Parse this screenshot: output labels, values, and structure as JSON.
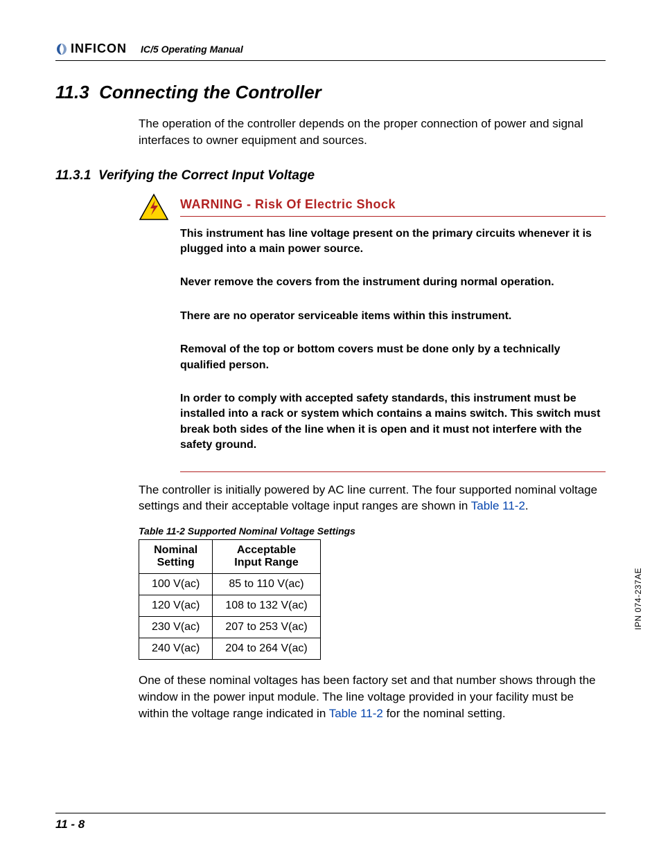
{
  "header": {
    "brand": "INFICON",
    "manual": "IC/5 Operating Manual"
  },
  "section": {
    "number": "11.3",
    "title": "Connecting the Controller",
    "intro": "The operation of the controller depends on the proper connection of power and signal interfaces to owner equipment and sources."
  },
  "subsection": {
    "number": "11.3.1",
    "title": "Verifying the Correct Input Voltage"
  },
  "warning": {
    "heading": "WARNING - Risk Of Electric Shock",
    "paragraphs": [
      "This instrument has line voltage present on the primary circuits whenever it is plugged into a main power source.",
      "Never remove the covers from the instrument during normal operation.",
      "There are no operator serviceable items within this instrument.",
      "Removal of the top or bottom covers must be done only by a technically qualified person.",
      "In order to comply with accepted safety standards, this instrument must be installed into a rack or system which contains a mains switch. This switch must break both sides of the line when it is open and it must not interfere with the safety ground."
    ]
  },
  "post_warning": {
    "text_before_link": "The controller is initially powered by AC line current. The four supported nominal voltage settings and their acceptable voltage input ranges are shown in ",
    "link": "Table 11-2",
    "text_after_link": "."
  },
  "table": {
    "caption": "Table 11-2  Supported Nominal Voltage Settings",
    "headers": {
      "col1_line1": "Nominal",
      "col1_line2": "Setting",
      "col2_line1": "Acceptable",
      "col2_line2": "Input Range"
    },
    "rows": [
      {
        "nominal": "100 V(ac)",
        "range": "85 to 110 V(ac)"
      },
      {
        "nominal": "120 V(ac)",
        "range": "108 to 132 V(ac)"
      },
      {
        "nominal": "230 V(ac)",
        "range": "207 to 253 V(ac)"
      },
      {
        "nominal": "240 V(ac)",
        "range": "204 to 264 V(ac)"
      }
    ]
  },
  "after_table": {
    "before": "One of these nominal voltages has been factory set and that number shows through the window in the power input module. The line voltage provided in your facility must be within the voltage range indicated in ",
    "link": "Table 11-2",
    "after": " for the nominal setting."
  },
  "footer": {
    "page": "11 - 8",
    "side": "IPN 074-237AE"
  }
}
